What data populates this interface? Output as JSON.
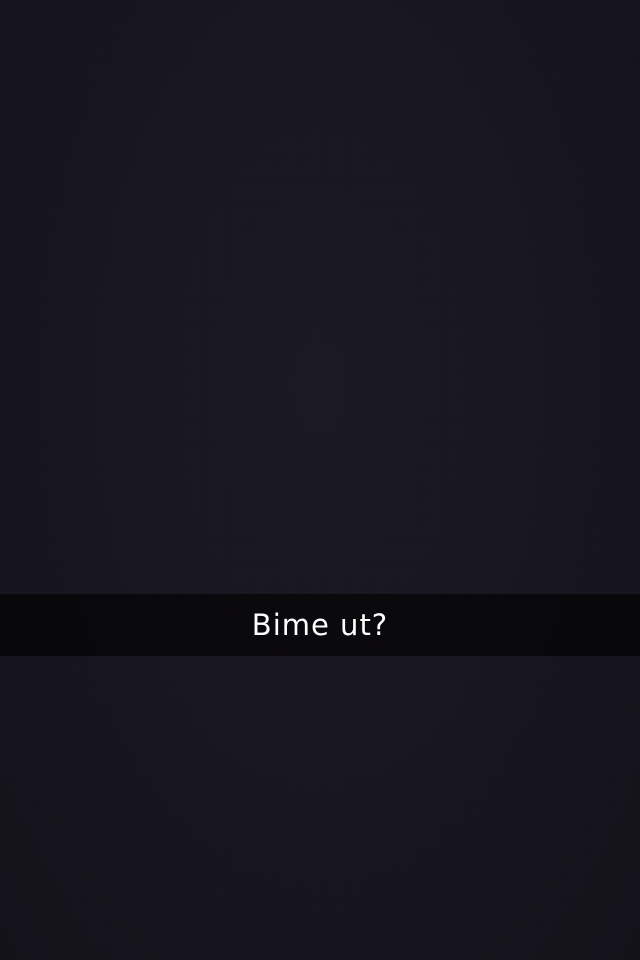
{
  "snap": {
    "background_color": "#16141d",
    "caption": {
      "text": "Bime ut?",
      "text_color": "#ffffff",
      "bar_color": "rgba(0,0,0,0.6)"
    }
  }
}
